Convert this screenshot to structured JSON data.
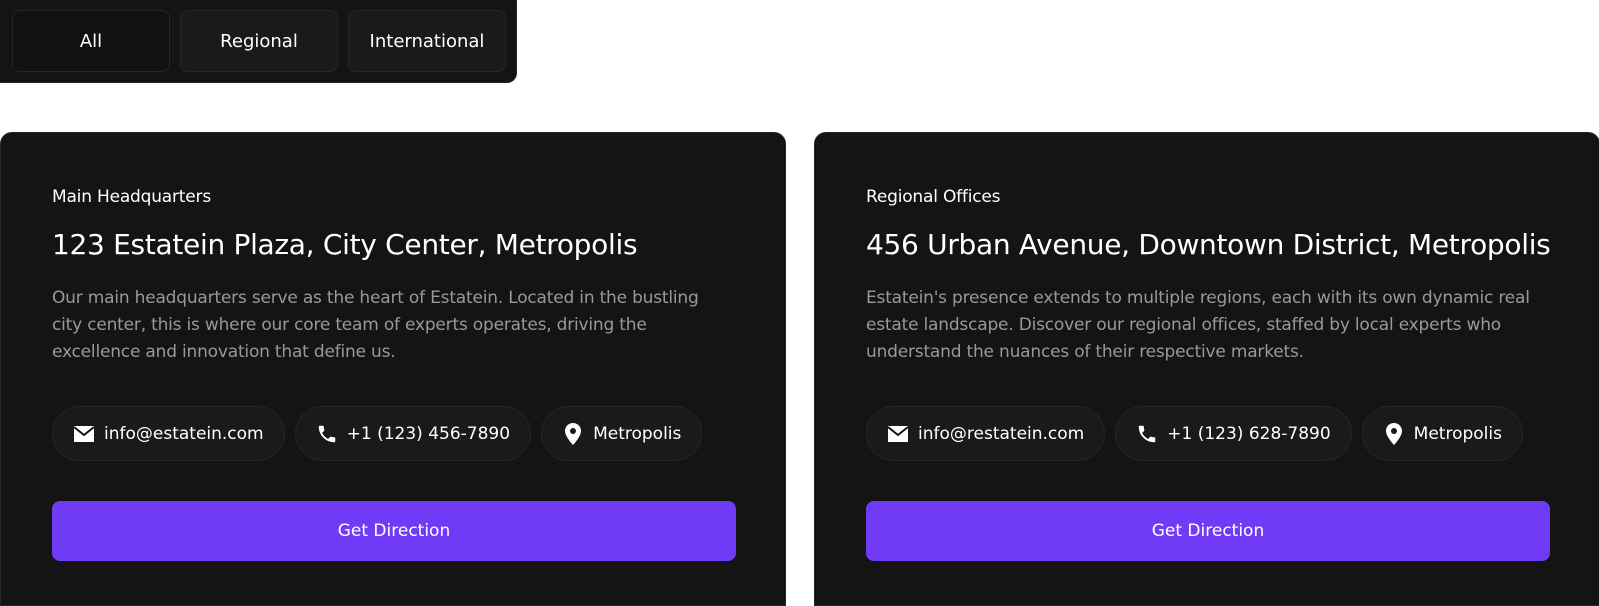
{
  "filters": {
    "tabs": [
      {
        "label": "All",
        "active": true
      },
      {
        "label": "Regional",
        "active": false
      },
      {
        "label": "International",
        "active": false
      }
    ]
  },
  "offices": [
    {
      "eyebrow": "Main Headquarters",
      "address": "123 Estatein Plaza, City Center, Metropolis",
      "description": "Our main headquarters serve as the heart of Estatein. Located in the bustling city center, this is where our core team of experts operates, driving the excellence and innovation that define us.",
      "email": "info@estatein.com",
      "phone": "+1 (123) 456-7890",
      "city": "Metropolis",
      "cta_label": "Get Direction"
    },
    {
      "eyebrow": "Regional Offices",
      "address": "456 Urban Avenue, Downtown District, Metropolis",
      "description": "Estatein's presence extends to multiple regions, each with its own dynamic real estate landscape. Discover our regional offices, staffed by local experts who understand the nuances of their respective markets.",
      "email": "info@restatein.com",
      "phone": "+1 (123) 628-7890",
      "city": "Metropolis",
      "cta_label": "Get Direction"
    }
  ],
  "icons": {
    "email": "envelope-icon",
    "phone": "phone-icon",
    "location": "map-pin-icon"
  },
  "colors": {
    "background": "#141414",
    "accent": "#703bf7",
    "muted_text": "#999999"
  }
}
